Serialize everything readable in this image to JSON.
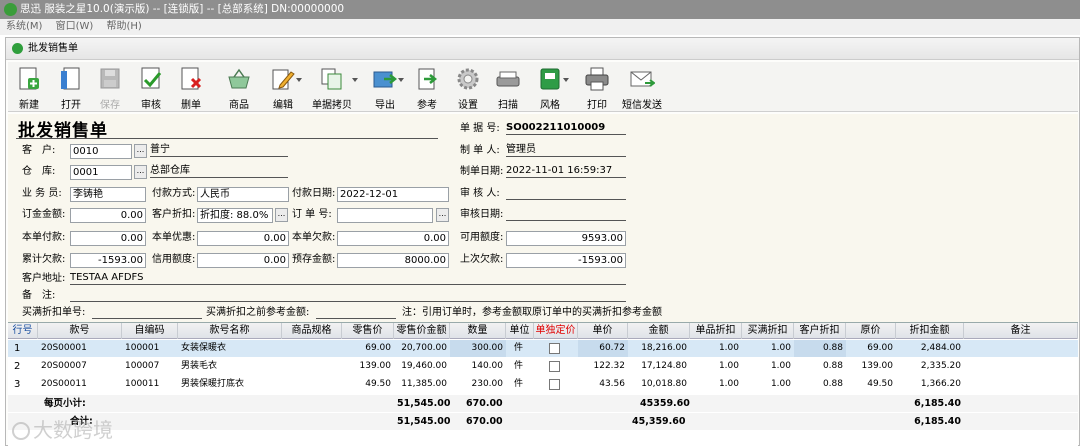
{
  "app": {
    "title": "思迅 服装之星10.0(演示版) -- [连锁版] -- [总部系统] DN:00000000"
  },
  "menu": [
    "系统(M)",
    "窗口(W)",
    "帮助(H)"
  ],
  "panel": {
    "title": "批发销售单"
  },
  "toolbar": [
    {
      "label": "新建",
      "icon": "new-doc-icon"
    },
    {
      "label": "打开",
      "icon": "open-doc-icon"
    },
    {
      "label": "保存",
      "icon": "save-icon"
    },
    {
      "label": "审核",
      "icon": "approve-check-icon"
    },
    {
      "label": "删单",
      "icon": "delete-doc-icon"
    },
    {
      "label": "商品",
      "icon": "product-basket-icon"
    },
    {
      "label": "编辑",
      "icon": "edit-pencil-icon"
    },
    {
      "label": "单据拷贝",
      "icon": "copy-doc-icon"
    },
    {
      "label": "导出",
      "icon": "export-icon"
    },
    {
      "label": "参考",
      "icon": "reference-icon"
    },
    {
      "label": "设置",
      "icon": "settings-gear-icon"
    },
    {
      "label": "扫描",
      "icon": "scanner-icon"
    },
    {
      "label": "风格",
      "icon": "style-icon"
    },
    {
      "label": "打印",
      "icon": "printer-icon"
    },
    {
      "label": "短信发送",
      "icon": "sms-mail-icon"
    }
  ],
  "form": {
    "title": "批发销售单",
    "customer_label": "客　户:",
    "customer_code": "0010",
    "customer_name": "普宁",
    "warehouse_label": "仓　库:",
    "warehouse_code": "0001",
    "warehouse_name": "总部仓库",
    "salesman_label": "业 务 员:",
    "salesman": "李铸艳",
    "paymethod_label": "付款方式:",
    "paymethod": "人民币",
    "paydate_label": "付款日期:",
    "paydate": "2022-12-01",
    "deposit_label": "订金金额:",
    "deposit": "0.00",
    "discount_label": "客户折扣:",
    "discount": "折扣度: 88.0%",
    "orderno_label": "订 单 号:",
    "orderno": "",
    "paid_label": "本单付款:",
    "paid": "0.00",
    "benefit_label": "本单优惠:",
    "benefit": "0.00",
    "owed_label": "本单欠款:",
    "owed": "0.00",
    "total_owed_label": "累计欠款:",
    "total_owed": "-1593.00",
    "credit_label": "信用额度:",
    "credit": "0.00",
    "prestore_label": "预存金额:",
    "prestore": "8000.00",
    "address_label": "客户地址:",
    "address": "TESTAA AFDFS",
    "remark_label": "备　注:",
    "remark": "",
    "buyout_label": "买满折扣单号:",
    "buyout_ref_label": "买满折扣之前参考金额:",
    "note": "注：引用订单时，参考金额取原订单中的买满折扣参考金额",
    "docno_label": "单 据 号:",
    "docno": "SO002211010009",
    "maker_label": "制 单 人:",
    "maker": "管理员",
    "makedate_label": "制单日期:",
    "makedate": "2022-11-01 16:59:37",
    "auditor_label": "审 核 人:",
    "auditor": "",
    "auditdate_label": "审核日期:",
    "auditdate": "",
    "available_label": "可用额度:",
    "available": "9593.00",
    "last_owed_label": "上次欠款:",
    "last_owed": "-1593.00"
  },
  "grid": {
    "headers": [
      "行号",
      "款号",
      "自编码",
      "款号名称",
      "商品规格",
      "零售价",
      "零售价金额",
      "数量",
      "单位",
      "单独定价",
      "单价",
      "金额",
      "单品折扣",
      "买满折扣",
      "客户折扣",
      "原价",
      "折扣金额",
      "备注"
    ],
    "special_header_color": "#e00000",
    "rows": [
      [
        "1",
        "20S00001",
        "100001",
        "女装保暖衣",
        "",
        "69.00",
        "20,700.00",
        "300.00",
        "件",
        "",
        "60.72",
        "18,216.00",
        "1.00",
        "1.00",
        "0.88",
        "69.00",
        "2,484.00",
        ""
      ],
      [
        "2",
        "20S00007",
        "100007",
        "男装毛衣",
        "",
        "139.00",
        "19,460.00",
        "140.00",
        "件",
        "",
        "122.32",
        "17,124.80",
        "1.00",
        "1.00",
        "0.88",
        "139.00",
        "2,335.20",
        ""
      ],
      [
        "3",
        "20S00011",
        "100011",
        "男装保暖打底衣",
        "",
        "49.50",
        "11,385.00",
        "230.00",
        "件",
        "",
        "43.56",
        "10,018.80",
        "1.00",
        "1.00",
        "0.88",
        "49.50",
        "1,366.20",
        ""
      ]
    ],
    "subtotal": {
      "label": "每页小计:",
      "retail_amount": "51,545.00",
      "qty": "670.00",
      "amount": "45359.60",
      "discount_amount": "6,185.40"
    },
    "total": {
      "label": "合计:",
      "retail_amount": "51,545.00",
      "qty": "670.00",
      "amount": "45,359.60",
      "discount_amount": "6,185.40"
    }
  },
  "watermark": "大数跨境"
}
